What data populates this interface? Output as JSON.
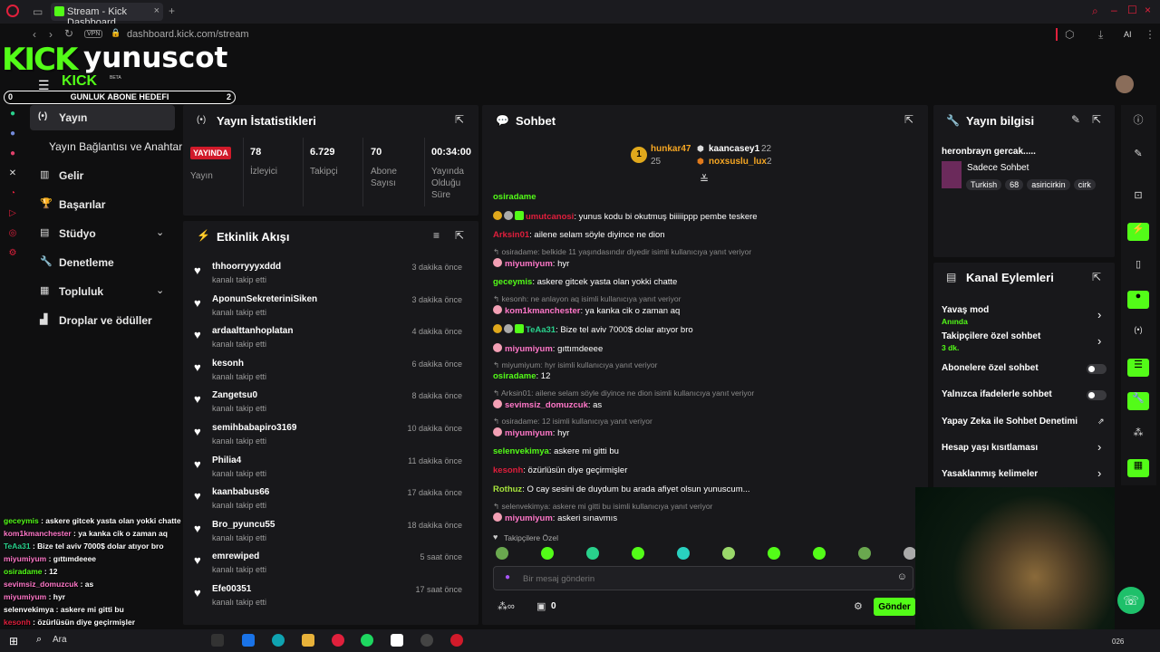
{
  "browser": {
    "tab_title": "Stream - Kick Dashboard",
    "url": "dashboard.kick.com/stream",
    "vpn": "VPN",
    "ai": "AI"
  },
  "brand": {
    "logo": "KICK",
    "logo_small": "KICK",
    "beta": "BETA",
    "username": "yunuscot",
    "goal_label": "GUNLUK ABONE HEDEFI",
    "goal_value": "2",
    "goal_start": "0"
  },
  "nav": {
    "items": [
      {
        "label": "Yayın"
      },
      {
        "label": "Yayın Bağlantısı ve Anahtarı"
      },
      {
        "label": "Gelir"
      },
      {
        "label": "Başarılar"
      },
      {
        "label": "Stüdyo"
      },
      {
        "label": "Denetleme"
      },
      {
        "label": "Topluluk"
      },
      {
        "label": "Droplar ve ödüller"
      }
    ]
  },
  "stats": {
    "title": "Yayın İstatistikleri",
    "live_badge": "YAYINDA",
    "live_label": "Yayın",
    "items": [
      {
        "value": "78",
        "label": "İzleyici"
      },
      {
        "value": "6.729",
        "label": "Takipçi"
      },
      {
        "value": "70",
        "label": "Abone Sayısı"
      },
      {
        "value": "00:34:00",
        "label": "Yayında Olduğu Süre"
      }
    ]
  },
  "feed": {
    "title": "Etkinlik Akışı",
    "subtitle": "kanalı takip etti",
    "items": [
      {
        "name": "thhoorryyyxddd",
        "time": "3 dakika önce"
      },
      {
        "name": "AponunSekreteriniSiken",
        "time": "3 dakika önce"
      },
      {
        "name": "ardaalttanhoplatan",
        "time": "4 dakika önce"
      },
      {
        "name": "kesonh",
        "time": "6 dakika önce"
      },
      {
        "name": "Zangetsu0",
        "time": "8 dakika önce"
      },
      {
        "name": "semihbabapiro3169",
        "time": "10 dakika önce"
      },
      {
        "name": "Philia4",
        "time": "11 dakika önce"
      },
      {
        "name": "kaanbabus66",
        "time": "17 dakika önce"
      },
      {
        "name": "Bro_pyuncu55",
        "time": "18 dakika önce"
      },
      {
        "name": "emrewiped",
        "time": "5 saat önce"
      },
      {
        "name": "Efe00351",
        "time": "17 saat önce"
      }
    ]
  },
  "chat": {
    "title": "Sohbet",
    "top_gifters": [
      {
        "name": "hunkar47",
        "count": "25",
        "rank": "1"
      },
      {
        "name": "kaancasey1",
        "count": "22"
      },
      {
        "name": "noxsuslu_lux",
        "count": "2"
      }
    ],
    "messages": [
      {
        "user": "osiradame",
        "text": ""
      },
      {
        "user": "umutcanosi",
        "text": ": yunus kodu bi okutmuş biiiiippp pembe teskere"
      },
      {
        "user": "Arksin01",
        "text": ": ailene selam söyle diyince ne dion"
      },
      {
        "reply": "osiradame: belkide 11 yaşındasındır diyedir isimli kullanıcıya yanıt veriyor"
      },
      {
        "user": "miyumiyum",
        "text": ": hyr"
      },
      {
        "user": "geceymis",
        "text": ": askere gitcek yasta olan yokki chatte"
      },
      {
        "reply": "kesonh: ne anlayon aq isimli kullanıcıya yanıt veriyor"
      },
      {
        "user": "kom1kmanchester",
        "text": ": ya kanka cik o zaman aq"
      },
      {
        "user": "TeAa31",
        "text": ": Bize tel aviv 7000$ dolar atıyor bro"
      },
      {
        "user": "miyumiyum",
        "text": ": gıttımdeeee"
      },
      {
        "reply": "miyumiyum: hyr isimli kullanıcıya yanıt veriyor"
      },
      {
        "user": "osiradame",
        "text": ": 12"
      },
      {
        "reply": "Arksin01: ailene selam söyle diyince ne dion isimli kullanıcıya yanıt veriyor"
      },
      {
        "user": "sevimsiz_domuzcuk",
        "text": ": as"
      },
      {
        "reply": "osiradame: 12 isimli kullanıcıya yanıt veriyor"
      },
      {
        "user": "miyumiyum",
        "text": ": hyr"
      },
      {
        "user": "selenvekimya",
        "text": ": askere mi gitti bu"
      },
      {
        "user": "kesonh",
        "text": ": özürlüsün diye geçirmişler"
      },
      {
        "user": "Rothuz",
        "text": ": O cay sesini de duydum bu arada afiyet olsun yunuscum..."
      },
      {
        "reply": "selenvekimya: askere mi gitti bu isimli kullanıcıya yanıt veriyor"
      },
      {
        "user": "miyumiyum",
        "text": ": askeri sınavmıs"
      }
    ],
    "followers_only": "Takipçilere Özel",
    "input_placeholder": "Bir mesaj gönderin",
    "points": "0",
    "send": "Gönder"
  },
  "info": {
    "title": "Yayın bilgisi",
    "stream_title": "heronbrayn gercak.....",
    "category": "Sadece Sohbet",
    "tags": [
      "Turkish",
      "68",
      "asiricirkin",
      "cirk"
    ]
  },
  "actions": {
    "title": "Kanal Eylemleri",
    "items": [
      {
        "label": "Yavaş mod",
        "sub": "Anında"
      },
      {
        "label": "Takipçilere özel sohbet",
        "sub": "3 dk."
      },
      {
        "label": "Abonelere özel sohbet"
      },
      {
        "label": "Yalnızca ifadelerle sohbet"
      },
      {
        "label": "Yapay Zeka ile Sohbet Denetimi"
      },
      {
        "label": "Hesap yaşı kısıtlaması"
      },
      {
        "label": "Yasaklanmış kelimeler"
      }
    ]
  },
  "overlay": {
    "lines": [
      {
        "user": "geceymis",
        "text": " : askere gitcek yasta olan yokki chatte"
      },
      {
        "user": "kom1kmanchester",
        "text": " : ya kanka cik o zaman aq"
      },
      {
        "user": "TeAa31",
        "text": " : Bize tel aviv 7000$ dolar atıyor bro"
      },
      {
        "user": "miyumiyum",
        "text": " : gıttımdeeee"
      },
      {
        "user": "osiradame",
        "text": " : 12"
      },
      {
        "user": "sevimsiz_domuzcuk",
        "text": " : as"
      },
      {
        "user": "miyumiyum",
        "text": " : hyr"
      },
      {
        "user": "selenvekimya",
        "text": " : askere mi gitti bu"
      },
      {
        "user": "kesonh",
        "text": " : özürlüsün diye geçirmişler"
      }
    ]
  },
  "taskbar": {
    "search": "Ara",
    "clock": "026"
  }
}
